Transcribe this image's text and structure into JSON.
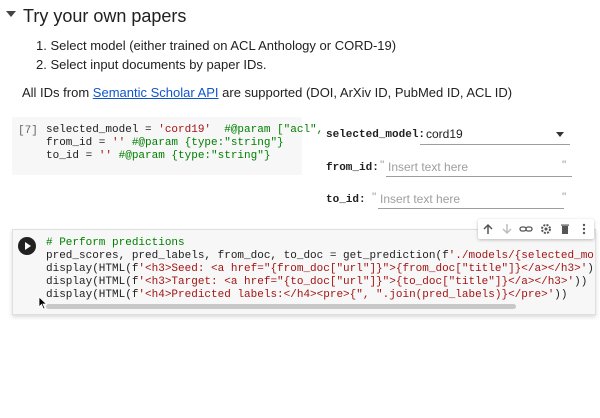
{
  "section": {
    "title": "Try your own papers",
    "steps": [
      "1. Select model (either trained on ACL Anthology or CORD-19)",
      "2. Select input documents by paper IDs."
    ],
    "ids_prefix": "All IDs from ",
    "ids_link": "Semantic Scholar API",
    "ids_suffix": " are supported (DOI, ArXiv ID, PubMed ID, ACL ID)"
  },
  "cell1": {
    "exec_count": "[7]",
    "line1_a": "selected_model = ",
    "line1_str": "'cord19'",
    "line1_cm": "  #@param [\"acl\",",
    "line2_a": "from_id = ",
    "line2_str": "''",
    "line2_cm": " #@param {type:\"string\"}",
    "line3_a": "to_id = ",
    "line3_str": "''",
    "line3_cm": " #@param {type:\"string\"}"
  },
  "form": {
    "selected_model_label": "selected_model:",
    "selected_model_value": "cord19",
    "from_id_label": "from_id:",
    "to_id_label": "to_id:",
    "placeholder": "Insert text here",
    "quote_open": "\"",
    "quote_close": "\""
  },
  "cell2": {
    "comment": "# Perform predictions",
    "l2_a": "pred_scores, pred_labels, from_doc, to_doc = get_prediction(f",
    "l2_s": "'./models/{selected_model}/scibe",
    "l3_a": "display(HTML(f",
    "l3_s": "'<h3>Seed: <a href=\"{from_doc[\"url\"]}\">{from_doc[\"title\"]}</a></h3>'",
    "l3_b": "))",
    "l4_a": "display(HTML(f",
    "l4_s": "'<h3>Target: <a href=\"{to_doc[\"url\"]}\">{to_doc[\"title\"]}</a></h3>'",
    "l4_b": "))",
    "l5_a": "display(HTML(f",
    "l5_s": "'<h4>Predicted labels:</h4><pre>{\", \".join(pred_labels)}</pre>'",
    "l5_b": "))"
  },
  "toolbar": {
    "icons": [
      "arrow-up-icon",
      "arrow-down-icon",
      "link-icon",
      "gear-icon",
      "trash-icon",
      "more-vert-icon"
    ]
  }
}
